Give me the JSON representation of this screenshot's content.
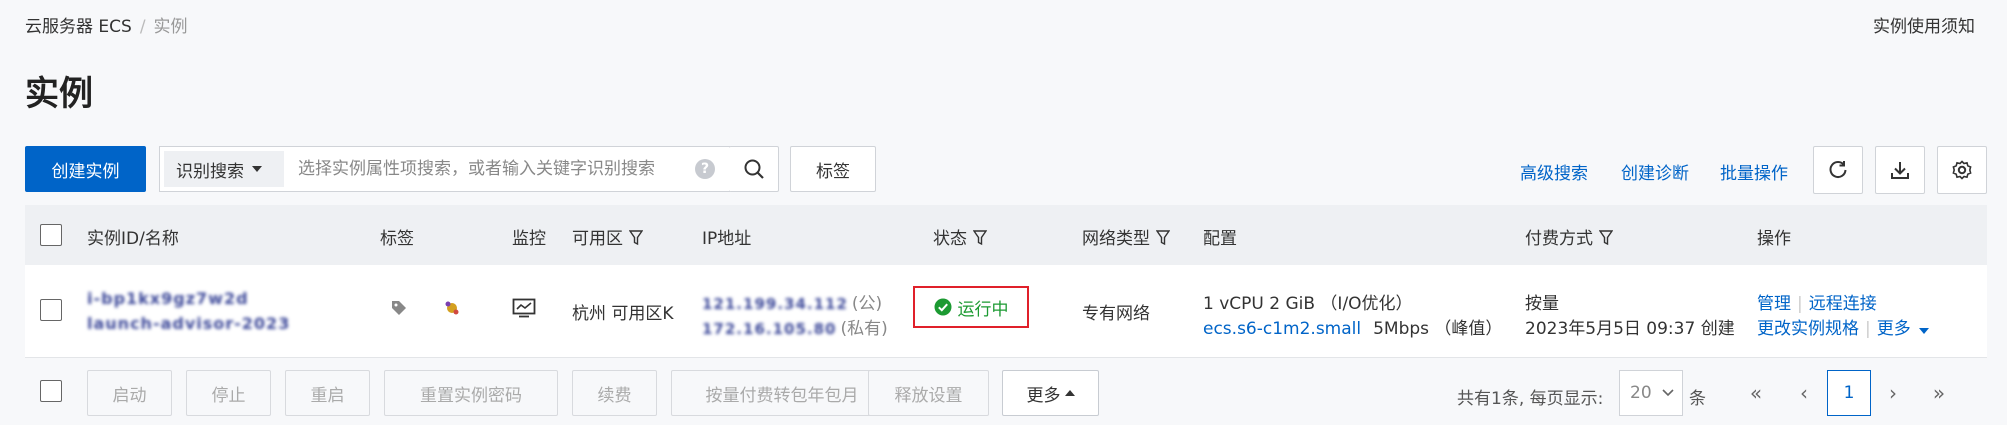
{
  "breadcrumb": {
    "root": "云服务器 ECS",
    "separator": "/",
    "current": "实例"
  },
  "help_link": "实例使用须知",
  "page_title": "实例",
  "toolbar": {
    "create_label": "创建实例",
    "search_type": "识别搜索",
    "search_placeholder": "选择实例属性项搜索，或者输入关键字识别搜索",
    "tag_label": "标签",
    "advanced_search": "高级搜索",
    "create_diagnosis": "创建诊断",
    "batch_ops": "批量操作"
  },
  "table": {
    "headers": {
      "id_name": "实例ID/名称",
      "tags": "标签",
      "monitor": "监控",
      "zone": "可用区",
      "ip": "IP地址",
      "status": "状态",
      "network": "网络类型",
      "config": "配置",
      "billing": "付费方式",
      "actions": "操作"
    },
    "rows": [
      {
        "id_line1": "i-bp1kx9gz7w2d",
        "id_line2": "launch-advisor-2023",
        "zone": "杭州 可用区K",
        "public_ip": "121.199.34.112",
        "public_suffix": "(公)",
        "private_ip": "172.16.105.80",
        "private_suffix": "(私有)",
        "status": "运行中",
        "network": "专有网络",
        "config_line1": "1 vCPU 2 GiB （I/O优化）",
        "config_spec": "ecs.s6-c1m2.small",
        "config_bandwidth": "5Mbps （峰值）",
        "billing_type": "按量",
        "created": "2023年5月5日 09:37 创建",
        "action_manage": "管理",
        "action_remote": "远程连接",
        "action_change": "更改实例规格",
        "action_more": "更多"
      }
    ]
  },
  "footer": {
    "buttons": [
      "启动",
      "停止",
      "重启",
      "重置实例密码",
      "续费",
      "按量付费转包年包月",
      "释放设置"
    ],
    "more_label": "更多",
    "total_text": "共有1条, 每页显示:",
    "page_size": "20",
    "unit": "条",
    "current_page": "1"
  }
}
